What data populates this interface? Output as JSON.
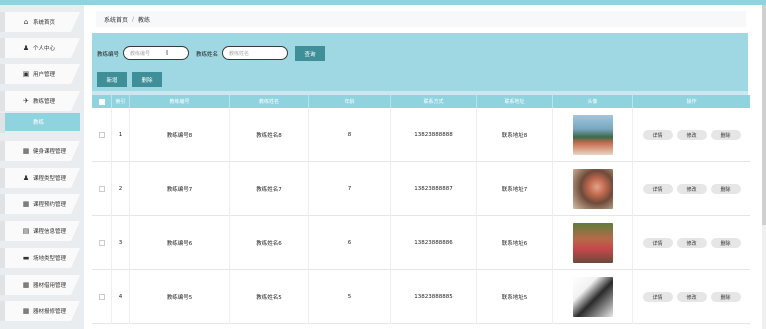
{
  "sidebar": {
    "items": [
      {
        "label": "系统首页",
        "icon": "home-icon",
        "glyph": "⌂"
      },
      {
        "label": "个人中心",
        "icon": "user-icon",
        "glyph": "♟"
      },
      {
        "label": "用户管理",
        "icon": "card-icon",
        "glyph": "▣"
      },
      {
        "label": "教练管理",
        "icon": "send-icon",
        "glyph": "✈"
      },
      {
        "label": "教练",
        "icon": "",
        "glyph": ""
      },
      {
        "label": "健身课程管理",
        "icon": "grid-icon",
        "glyph": "▦"
      },
      {
        "label": "课程类型管理",
        "icon": "person-icon",
        "glyph": "♟"
      },
      {
        "label": "课程预约管理",
        "icon": "grid-icon",
        "glyph": "▦"
      },
      {
        "label": "课程信息管理",
        "icon": "table-icon",
        "glyph": "▤"
      },
      {
        "label": "场地类型管理",
        "icon": "monitor-icon",
        "glyph": "▬"
      },
      {
        "label": "器材借用管理",
        "icon": "grid-icon",
        "glyph": "▦"
      },
      {
        "label": "器材报修管理",
        "icon": "grid-icon",
        "glyph": "▦"
      }
    ]
  },
  "breadcrumb": {
    "home": "系统首页",
    "separator": "/",
    "current": "教练"
  },
  "search": {
    "label_id": "教练编号",
    "placeholder_id": "教练编号",
    "label_name": "教练姓名",
    "placeholder_name": "教练姓名",
    "search_button": "查询"
  },
  "actions": {
    "add": "新增",
    "delete": "删除"
  },
  "table": {
    "headers": [
      "索引",
      "教练编号",
      "教练姓名",
      "年龄",
      "联系方式",
      "联系地址",
      "头像",
      "操作"
    ],
    "rows": [
      {
        "index": "1",
        "id": "教练编号8",
        "name": "教练姓名8",
        "age": "8",
        "phone": "13823888888",
        "address": "联系地址8",
        "photo": "photo-1"
      },
      {
        "index": "2",
        "id": "教练编号7",
        "name": "教练姓名7",
        "age": "7",
        "phone": "13823888887",
        "address": "联系地址7",
        "photo": "photo-2"
      },
      {
        "index": "3",
        "id": "教练编号6",
        "name": "教练姓名6",
        "age": "6",
        "phone": "13823888886",
        "address": "联系地址6",
        "photo": "photo-3"
      },
      {
        "index": "4",
        "id": "教练编号5",
        "name": "教练姓名5",
        "age": "5",
        "phone": "13823888885",
        "address": "联系地址5",
        "photo": "photo-4"
      }
    ],
    "row_actions": {
      "detail": "详情",
      "edit": "修改",
      "delete": "删除"
    }
  },
  "colors": {
    "accent": "#8fd3df",
    "button": "#3f8f99"
  }
}
